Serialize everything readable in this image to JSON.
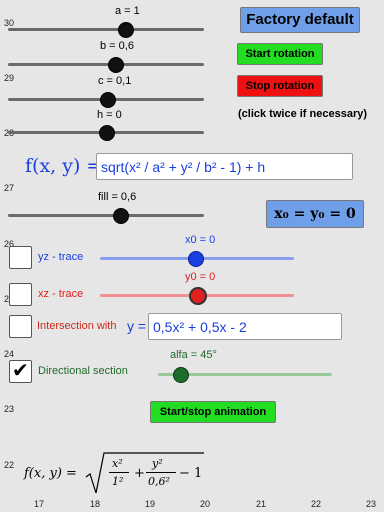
{
  "grid": {
    "y_labels": [
      "30",
      "29",
      "28",
      "27",
      "26",
      "25",
      "24",
      "23",
      "22"
    ],
    "x_labels": [
      "17",
      "18",
      "19",
      "20",
      "21",
      "22",
      "23"
    ]
  },
  "sliders": {
    "a": {
      "label": "a = 1",
      "value": 1
    },
    "b": {
      "label": "b = 0,6",
      "value": 0.6
    },
    "c": {
      "label": "c = 0,1",
      "value": 0.1
    },
    "h": {
      "label": "h = 0",
      "value": 0
    },
    "fill": {
      "label": "fill = 0,6",
      "value": 0.6
    },
    "x0": {
      "label": "x0 = 0",
      "value": 0,
      "color": "#1a3fe0"
    },
    "y0": {
      "label": "y0 = 0",
      "value": 0,
      "color": "#e02020"
    },
    "alfa": {
      "label": "alfa = 45°",
      "value": 45,
      "color": "#1e6b2a"
    }
  },
  "buttons": {
    "factory_default": {
      "label": "Factory default",
      "color": "#6f9fe8"
    },
    "start_rotation": {
      "label": "Start rotation",
      "color": "#22dd22"
    },
    "stop_rotation": {
      "label": "Stop rotation",
      "color": "#ee1111"
    },
    "start_stop_animation": {
      "label": "Start/stop animation",
      "color": "#22dd22"
    }
  },
  "note": "(click twice if necessary)",
  "function_input": {
    "prefix": "f(x, y) =",
    "value": "sqrt(x² / a² + y² / b² - 1) + h"
  },
  "x0_eq_y0_box": "x₀ = y₀ = 0",
  "checkboxes": {
    "yz_trace": {
      "label": "yz - trace",
      "checked": false,
      "color": "#1a3fe0"
    },
    "xz_trace": {
      "label": "xz - trace",
      "checked": false,
      "color": "#e02020"
    },
    "intersection": {
      "label": "Intersection with",
      "checked": false,
      "color": "#cc2a1a"
    },
    "directional": {
      "label": "Directional section",
      "checked": true,
      "color": "#1e6b2a"
    }
  },
  "intersection_input": {
    "prefix": "y =",
    "value": "0,5x² + 0,5x - 2"
  },
  "formula": {
    "lhs": "f(x, y) =",
    "num1": "x²",
    "den1": "1²",
    "plus": "+",
    "num2": "y²",
    "den2": "0,6²",
    "tail": "− 1"
  }
}
